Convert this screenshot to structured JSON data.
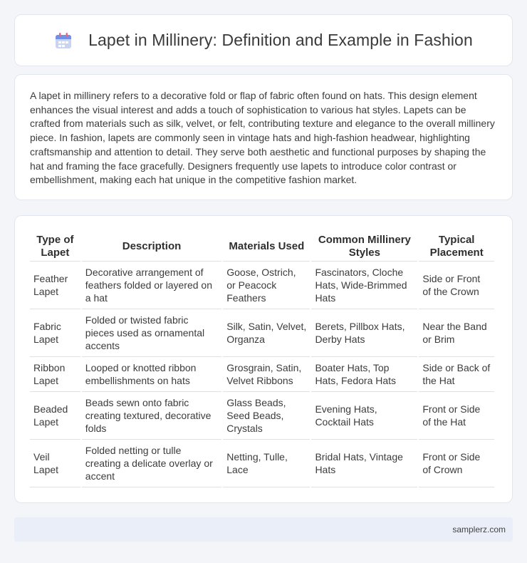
{
  "header": {
    "title": "Lapet in Millinery: Definition and Example in Fashion",
    "icon": "calendar-icon"
  },
  "intro": {
    "text": "A lapet in millinery refers to a decorative fold or flap of fabric often found on hats. This design element enhances the visual interest and adds a touch of sophistication to various hat styles. Lapets can be crafted from materials such as silk, velvet, or felt, contributing texture and elegance to the overall millinery piece. In fashion, lapets are commonly seen in vintage hats and high-fashion headwear, highlighting craftsmanship and attention to detail. They serve both aesthetic and functional purposes by shaping the hat and framing the face gracefully. Designers frequently use lapets to introduce color contrast or embellishment, making each hat unique in the competitive fashion market."
  },
  "table": {
    "headers": [
      "Type of Lapet",
      "Description",
      "Materials Used",
      "Common Millinery Styles",
      "Typical Placement"
    ],
    "rows": [
      [
        "Feather Lapet",
        "Decorative arrangement of feathers folded or layered on a hat",
        "Goose, Ostrich, or Peacock Feathers",
        "Fascinators, Cloche Hats, Wide-Brimmed Hats",
        "Side or Front of the Crown"
      ],
      [
        "Fabric Lapet",
        "Folded or twisted fabric pieces used as ornamental accents",
        "Silk, Satin, Velvet, Organza",
        "Berets, Pillbox Hats, Derby Hats",
        "Near the Band or Brim"
      ],
      [
        "Ribbon Lapet",
        "Looped or knotted ribbon embellishments on hats",
        "Grosgrain, Satin, Velvet Ribbons",
        "Boater Hats, Top Hats, Fedora Hats",
        "Side or Back of the Hat"
      ],
      [
        "Beaded Lapet",
        "Beads sewn onto fabric creating textured, decorative folds",
        "Glass Beads, Seed Beads, Crystals",
        "Evening Hats, Cocktail Hats",
        "Front or Side of the Hat"
      ],
      [
        "Veil Lapet",
        "Folded netting or tulle creating a delicate overlay or accent",
        "Netting, Tulle, Lace",
        "Bridal Hats, Vintage Hats",
        "Front or Side of Crown"
      ]
    ]
  },
  "footer": {
    "text": "samplerz.com"
  }
}
